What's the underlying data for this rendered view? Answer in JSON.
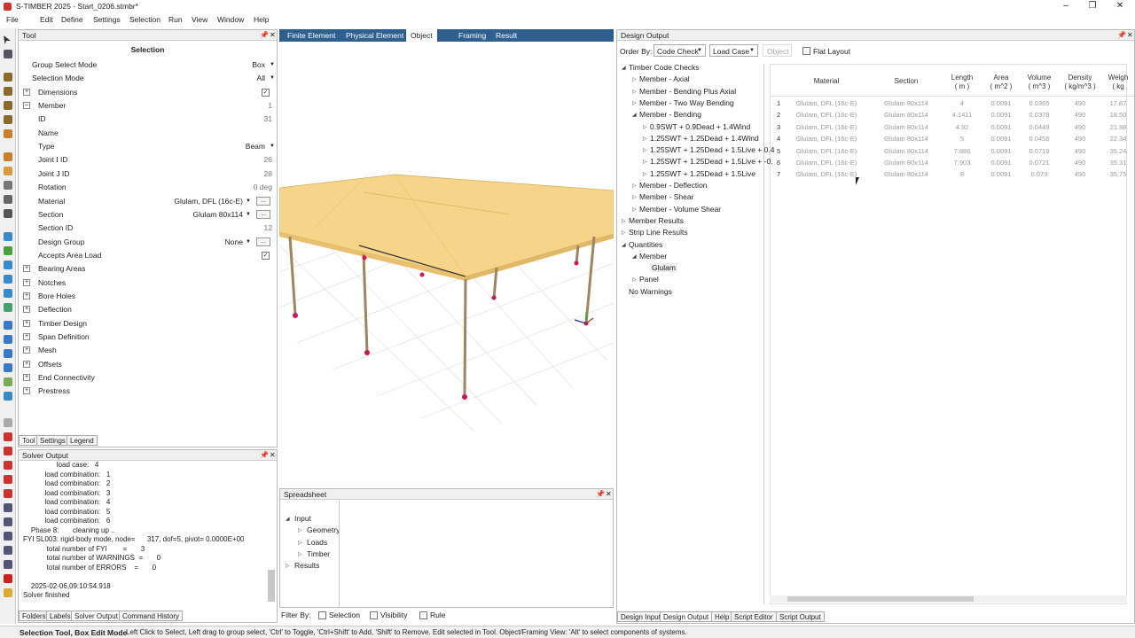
{
  "window": {
    "title": "S-TIMBER 2025 - Start_0206.stmbr*",
    "min_icon": "minimize-icon",
    "max_icon": "restore-icon",
    "close_icon": "close-icon"
  },
  "menu": [
    "File",
    "Edit",
    "Define",
    "Settings",
    "Selection",
    "Run",
    "View",
    "Window",
    "Help"
  ],
  "tool_panel": {
    "header": "Tool",
    "heading": "Selection",
    "rows": [
      {
        "label": "Group Select Mode",
        "value": "Box",
        "type": "dropdown"
      },
      {
        "label": "Selection Mode",
        "value": "All",
        "type": "dropdown"
      },
      {
        "label": "Dimensions",
        "value": "✓",
        "type": "check-expand"
      },
      {
        "label": "Member",
        "value": "1",
        "type": "expand-open"
      },
      {
        "label": "ID",
        "value": "31",
        "type": "text"
      },
      {
        "label": "Name",
        "value": "",
        "type": "text"
      },
      {
        "label": "Type",
        "value": "Beam",
        "type": "dropdown"
      },
      {
        "label": "Joint I ID",
        "value": "26",
        "type": "text"
      },
      {
        "label": "Joint J ID",
        "value": "28",
        "type": "text"
      },
      {
        "label": "Rotation",
        "value": "0  deg",
        "type": "text"
      },
      {
        "label": "Material",
        "value": "Glulam, DFL (16c-E)",
        "type": "dropdown-dots"
      },
      {
        "label": "Section",
        "value": "Glulam 80x114",
        "type": "dropdown-dots"
      },
      {
        "label": "Section ID",
        "value": "12",
        "type": "text"
      },
      {
        "label": "Design Group",
        "value": "None",
        "type": "dropdown-dots"
      },
      {
        "label": "Accepts Area Load",
        "value": "✓",
        "type": "check"
      },
      {
        "label": "Bearing Areas",
        "value": "",
        "type": "expand"
      },
      {
        "label": "Notches",
        "value": "",
        "type": "expand"
      },
      {
        "label": "Bore Holes",
        "value": "",
        "type": "expand"
      },
      {
        "label": "Deflection",
        "value": "",
        "type": "expand"
      },
      {
        "label": "Timber Design",
        "value": "",
        "type": "expand"
      },
      {
        "label": "Span Definition",
        "value": "",
        "type": "expand"
      },
      {
        "label": "Mesh",
        "value": "",
        "type": "expand"
      },
      {
        "label": "Offsets",
        "value": "",
        "type": "expand"
      },
      {
        "label": "End Connectivity",
        "value": "",
        "type": "expand"
      },
      {
        "label": "Prestress",
        "value": "",
        "type": "expand"
      }
    ],
    "tabs": [
      "Tool",
      "Settings",
      "Legend"
    ]
  },
  "viewport": {
    "tabs": [
      "Finite Element",
      "Physical Element",
      "Object",
      "Framing",
      "Result"
    ],
    "active_tab": "Object"
  },
  "solver": {
    "header": "Solver Output",
    "lines": [
      "                 load case:   4",
      "           load combination:   1",
      "           load combination:   2",
      "           load combination:   3",
      "           load combination:   4",
      "           load combination:   5",
      "           load combination:   6",
      "    Phase 8:       cleaning up ..",
      "FYI SL003: rigid-body mode, node=      317, dof=5, pivot= 0.0000E+00",
      "            total number of FYI        =       3",
      "            total number of WARNINGS  =       0",
      "            total number of ERRORS    =       0",
      "",
      "    2025-02-06,09:10:54.918",
      "Solver finished"
    ],
    "tabs": [
      "Folders",
      "Labels",
      "Solver Output",
      "Command History"
    ]
  },
  "spreadsheet": {
    "header": "Spreadsheet",
    "tree": [
      {
        "label": "Input",
        "indent": 0,
        "open": true
      },
      {
        "label": "Geometry",
        "indent": 1,
        "open": false
      },
      {
        "label": "Loads",
        "indent": 1,
        "open": false
      },
      {
        "label": "Timber",
        "indent": 1,
        "open": false
      },
      {
        "label": "Results",
        "indent": 0,
        "open": false
      }
    ],
    "filter_label": "Filter By:",
    "filters": [
      "Selection",
      "Visibility",
      "Rule"
    ]
  },
  "design_output": {
    "header": "Design Output",
    "order_by_label": "Order By:",
    "order_by": "Code Check",
    "load_case": "Load Case",
    "object_btn": "Object",
    "flat_layout": "Flat Layout",
    "tree": [
      {
        "label": "Timber Code Checks",
        "indent": 0,
        "tri": "open"
      },
      {
        "label": "Member - Axial",
        "indent": 1,
        "tri": "closed"
      },
      {
        "label": "Member - Bending Plus Axial",
        "indent": 1,
        "tri": "closed"
      },
      {
        "label": "Member - Two Way Bending",
        "indent": 1,
        "tri": "closed"
      },
      {
        "label": "Member - Bending",
        "indent": 1,
        "tri": "open"
      },
      {
        "label": "0.9SWT + 0.9Dead + 1.4Wind",
        "indent": 2,
        "tri": "closed"
      },
      {
        "label": "1.25SWT + 1.25Dead + 1.4Wind",
        "indent": 2,
        "tri": "closed"
      },
      {
        "label": "1.25SWT + 1.25Dead + 1.5Live + 0.4",
        "indent": 2,
        "tri": "closed"
      },
      {
        "label": "1.25SWT + 1.25Dead + 1.5Live + -0.",
        "indent": 2,
        "tri": "closed"
      },
      {
        "label": "1.25SWT + 1.25Dead + 1.5Live",
        "indent": 2,
        "tri": "closed"
      },
      {
        "label": "Member - Deflection",
        "indent": 1,
        "tri": "closed"
      },
      {
        "label": "Member - Shear",
        "indent": 1,
        "tri": "closed"
      },
      {
        "label": "Member - Volume Shear",
        "indent": 1,
        "tri": "closed"
      },
      {
        "label": "Member Results",
        "indent": 0,
        "tri": "closed"
      },
      {
        "label": "Strip Line Results",
        "indent": 0,
        "tri": "closed"
      },
      {
        "label": "Quantities",
        "indent": 0,
        "tri": "open"
      },
      {
        "label": "Member",
        "indent": 1,
        "tri": "open"
      },
      {
        "label": "Glulam",
        "indent": 2,
        "tri": "none"
      },
      {
        "label": "Panel",
        "indent": 1,
        "tri": "closed"
      },
      {
        "label": "No Warnings",
        "indent": 0,
        "tri": "none"
      }
    ],
    "columns": [
      "Material",
      "Section",
      "Length\n( m )",
      "Area\n( m^2 )",
      "Volume\n( m^3 )",
      "Density\n( kg/m^3 )",
      "Weigh\n( kg"
    ],
    "rows": [
      [
        "1",
        "Glulam, DFL (16c-E)",
        "Glulam 80x114",
        "4",
        "0.0091",
        "0.0365",
        "490",
        "17.87"
      ],
      [
        "2",
        "Glulam, DFL (16c-E)",
        "Glulam 80x114",
        "4.1411",
        "0.0091",
        "0.0378",
        "490",
        "18.50"
      ],
      [
        "3",
        "Glulam, DFL (16c-E)",
        "Glulam 80x114",
        "4.92",
        "0.0091",
        "0.0449",
        "490",
        "21.98"
      ],
      [
        "4",
        "Glulam, DFL (16c-E)",
        "Glulam 80x114",
        "5",
        "0.0091",
        "0.0456",
        "490",
        "22.34"
      ],
      [
        "5",
        "Glulam, DFL (16c-E)",
        "Glulam 80x114",
        "7.886",
        "0.0091",
        "0.0719",
        "490",
        "35.24"
      ],
      [
        "6",
        "Glulam, DFL (16c-E)",
        "Glulam 80x114",
        "7.903",
        "0.0091",
        "0.0721",
        "490",
        "35.31"
      ],
      [
        "7",
        "Glulam, DFL (16c-E)",
        "Glulam 80x114",
        "8",
        "0.0091",
        "0.073",
        "490",
        "35.75"
      ]
    ],
    "tabs": [
      "Design Input",
      "Design Output",
      "Help",
      "Script Editor",
      "Script Output"
    ]
  },
  "status": {
    "mode": "Selection Tool, Box Edit Mode",
    "hint": "Left Click to Select, Left drag to group select, 'Ctrl' to Toggle, 'Ctrl+Shift' to Add, 'Shift' to Remove. Edit selected in Tool. Object/Framing View: 'Alt' to select components of systems."
  },
  "colors": {
    "tab_bar": "#2f5f8f",
    "roof": "#f6d58a",
    "column": "#a08460",
    "support": "#d0145a"
  }
}
